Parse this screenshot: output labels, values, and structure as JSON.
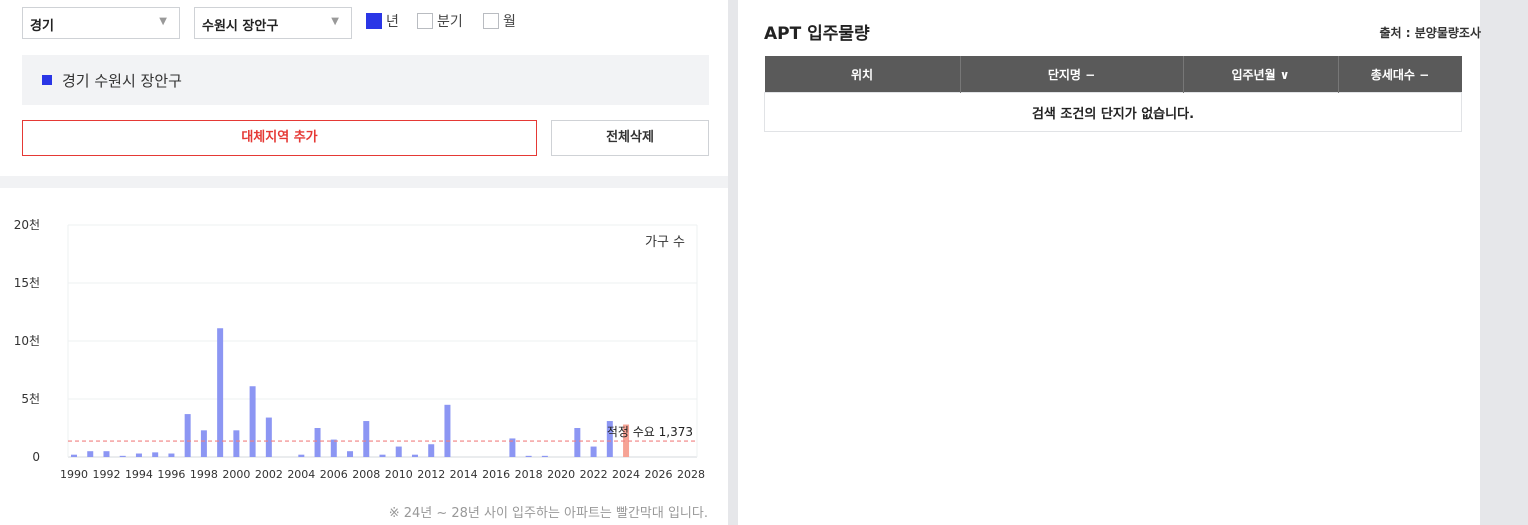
{
  "filters": {
    "province": "경기",
    "district": "수원시 장안구",
    "period_options": [
      {
        "label": "년",
        "checked": true
      },
      {
        "label": "분기",
        "checked": false
      },
      {
        "label": "월",
        "checked": false
      }
    ]
  },
  "selected_region": "경기 수원시 장안구",
  "buttons": {
    "add_region": "대체지역 추가",
    "delete_all": "전체삭제"
  },
  "chart_note": "※ 24년 ~ 28년 사이 입주하는 아파트는 빨간막대 입니다.",
  "apt": {
    "title": "APT 입주물량",
    "source": "출처 : 분양물량조사",
    "columns": [
      "위치",
      "단지명 −",
      "입주년월 ∨",
      "총세대수 −"
    ],
    "empty_message": "검색 조건의 단지가 없습니다."
  },
  "chart_data": {
    "type": "bar",
    "legend_label": "가구 수",
    "ytick_labels": [
      "0",
      "5천",
      "10천",
      "15천",
      "20천"
    ],
    "ylim": [
      0,
      20000
    ],
    "yticks": [
      0,
      5000,
      10000,
      15000,
      20000
    ],
    "xtick_labels": [
      "1990",
      "1992",
      "1994",
      "1996",
      "1998",
      "2000",
      "2002",
      "2004",
      "2006",
      "2008",
      "2010",
      "2012",
      "2014",
      "2016",
      "2018",
      "2020",
      "2022",
      "2024",
      "2026",
      "2028"
    ],
    "grid": true,
    "categories": [
      1990,
      1991,
      1992,
      1993,
      1994,
      1995,
      1996,
      1997,
      1998,
      1999,
      2000,
      2001,
      2002,
      2003,
      2004,
      2005,
      2006,
      2007,
      2008,
      2009,
      2010,
      2011,
      2012,
      2013,
      2014,
      2015,
      2016,
      2017,
      2018,
      2019,
      2020,
      2021,
      2022,
      2023,
      2024,
      2025,
      2026,
      2027,
      2028
    ],
    "values": [
      200,
      500,
      500,
      100,
      300,
      400,
      300,
      3700,
      2300,
      11100,
      2300,
      6100,
      3400,
      0,
      200,
      2500,
      1500,
      500,
      3100,
      200,
      900,
      200,
      1100,
      4500,
      0,
      0,
      0,
      1600,
      100,
      100,
      0,
      2500,
      900,
      3100,
      2800,
      0,
      0,
      0,
      0
    ],
    "highlight_years_from": 2024,
    "bar_color": "#8c96f3",
    "highlight_color": "#f6a395",
    "reference_line": {
      "value": 1373,
      "label": "적정 수요 1,373",
      "color": "#f08080"
    }
  }
}
